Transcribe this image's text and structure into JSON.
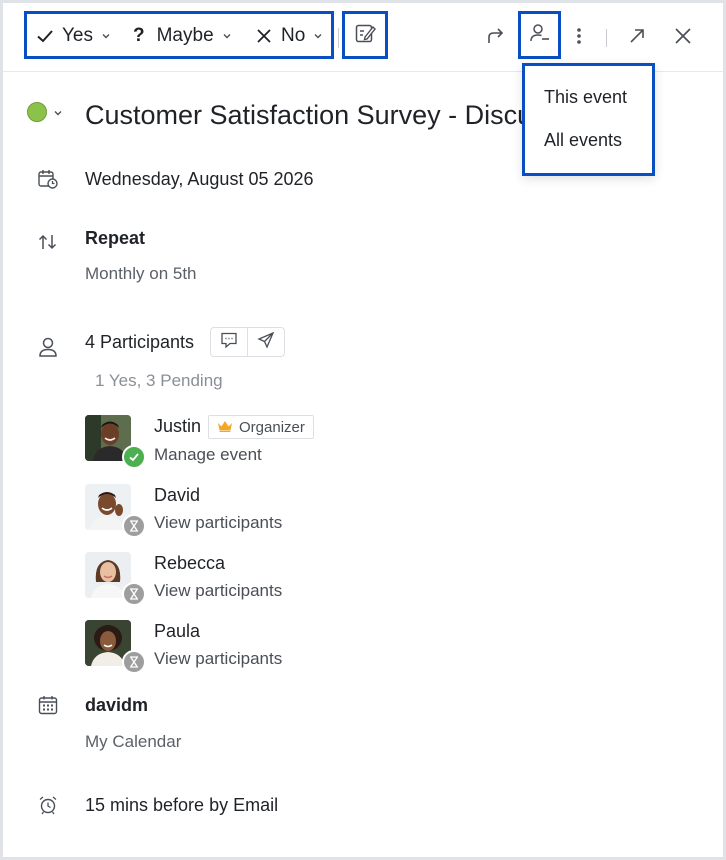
{
  "toolbar": {
    "yes_label": "Yes",
    "maybe_label": "Maybe",
    "no_label": "No",
    "icons": [
      "check-icon",
      "question-icon",
      "x-icon",
      "chevron-down-icon",
      "edit-note-icon",
      "forward-icon",
      "user-minus-icon",
      "more-vertical-icon",
      "expand-icon",
      "close-icon"
    ]
  },
  "dropdown": {
    "items": [
      {
        "label": "This event"
      },
      {
        "label": "All events"
      }
    ]
  },
  "event": {
    "status_color": "#8bc34a",
    "title": "Customer Satisfaction Survey - Discuss",
    "date": "Wednesday, August 05 2026",
    "repeat_label": "Repeat",
    "repeat_detail": "Monthly on 5th"
  },
  "participants": {
    "heading": "4 Participants",
    "summary": "1 Yes, 3 Pending",
    "organizer_badge": "Organizer",
    "list": [
      {
        "name": "Justin",
        "action": "Manage event",
        "status": "yes"
      },
      {
        "name": "David",
        "action": "View participants",
        "status": "pending"
      },
      {
        "name": "Rebecca",
        "action": "View participants",
        "status": "pending"
      },
      {
        "name": "Paula",
        "action": "View participants",
        "status": "pending"
      }
    ]
  },
  "calendar": {
    "owner": "davidm",
    "name": "My Calendar"
  },
  "reminder": {
    "text": "15 mins before by Email"
  },
  "colors": {
    "accent_highlight": "#0a4ec4",
    "yes_green": "#4caf50",
    "pending_grey": "#9e9e9e",
    "crown": "#f5a623"
  }
}
